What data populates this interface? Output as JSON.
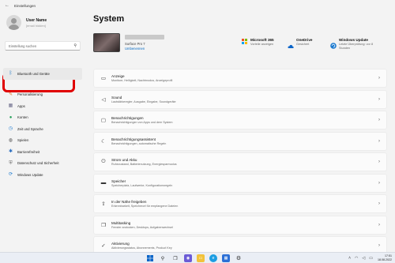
{
  "window": {
    "title": "Einstellungen"
  },
  "user": {
    "name": "User Name",
    "subtitle": "[email hidden]"
  },
  "search": {
    "placeholder": "Einstellung suchen"
  },
  "sidebar": {
    "items": [
      {
        "label": "Bluetooth und Geräte",
        "icon": "bluetooth-icon"
      },
      {
        "label": "Personalisierung",
        "icon": "brush-icon"
      },
      {
        "label": "Apps",
        "icon": "apps-icon"
      },
      {
        "label": "Konten",
        "icon": "person-icon"
      },
      {
        "label": "Zeit und Sprache",
        "icon": "globe-clock-icon"
      },
      {
        "label": "Spielen",
        "icon": "gamepad-icon"
      },
      {
        "label": "Barrierefreiheit",
        "icon": "accessibility-icon"
      },
      {
        "label": "Datenschutz und Sicherheit",
        "icon": "shield-icon"
      },
      {
        "label": "Windows Update",
        "icon": "update-icon"
      }
    ]
  },
  "main": {
    "title": "System",
    "device": {
      "model": "Surface Pro 7",
      "rename_link": "Umbenennen"
    },
    "status": [
      {
        "title": "Microsoft 365",
        "subtitle": "Vorteile anzeigen",
        "icon": "microsoft-365-icon"
      },
      {
        "title": "OneDrive",
        "subtitle": "Gesichert",
        "icon": "onedrive-icon"
      },
      {
        "title": "Windows Update",
        "subtitle": "Letzte Überprüfung: vor 8 Stunden",
        "icon": "windows-update-icon"
      }
    ],
    "cards": [
      {
        "title": "Anzeige",
        "subtitle": "Monitore, Helligkeit, Nachtmodus, Anzeigeprofil",
        "icon": "display-icon"
      },
      {
        "title": "Sound",
        "subtitle": "Lautstärkeregler, Ausgabe, Eingabe, Soundgeräte",
        "icon": "speaker-icon"
      },
      {
        "title": "Benachrichtigungen",
        "subtitle": "Benachrichtigungen von Apps und dem System",
        "icon": "bell-icon"
      },
      {
        "title": "Benachrichtigungsassistent",
        "subtitle": "Benachrichtigungen, automatische Regeln",
        "icon": "moon-icon"
      },
      {
        "title": "Strom und Akku",
        "subtitle": "Ruhezustand, Batterienutzung, Energiesparmodus",
        "icon": "power-icon"
      },
      {
        "title": "Speicher",
        "subtitle": "Speicherplatz, Laufwerke, Konfigurationsregeln",
        "icon": "storage-icon"
      },
      {
        "title": "In der Nähe freigeben",
        "subtitle": "Erkennbarkeit, Speicherort für empfangene Dateien",
        "icon": "share-icon"
      },
      {
        "title": "Multitasking",
        "subtitle": "Fenster andocken, Desktops, Aufgabenwechsel",
        "icon": "multitasking-icon"
      },
      {
        "title": "Aktivierung",
        "subtitle": "Aktivierungsstatus, Abonnements, Product Key",
        "icon": "activation-icon"
      }
    ]
  },
  "taskbar": {
    "time": "17:51",
    "date": "18.08.2022"
  },
  "colors": {
    "accent": "#0067c0",
    "highlight": "#e00000",
    "background": "#f3f3f3"
  }
}
